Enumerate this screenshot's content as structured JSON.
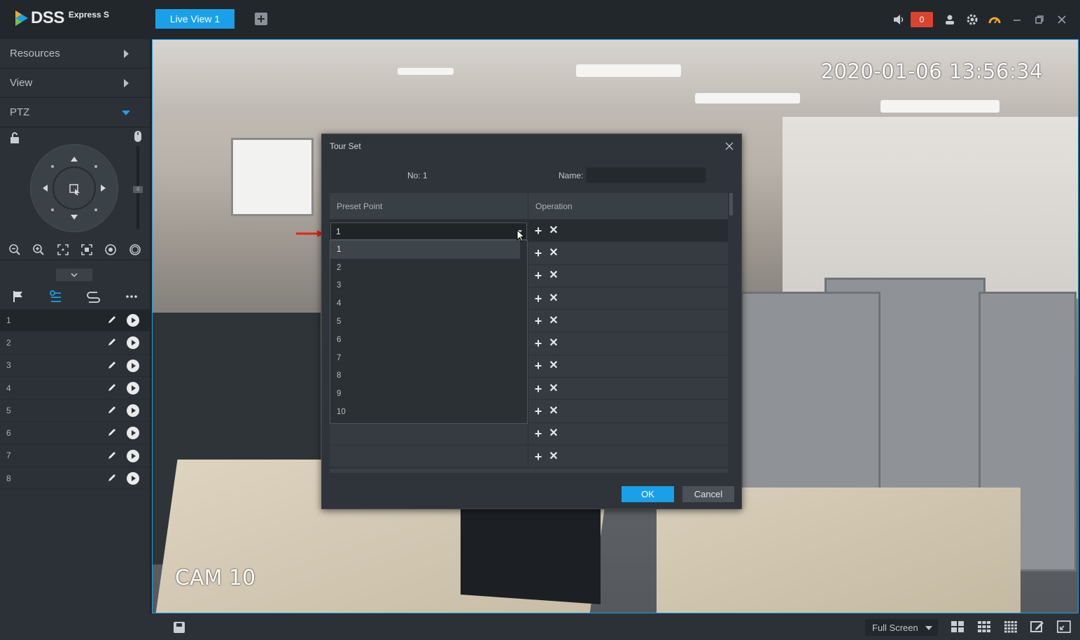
{
  "app": {
    "brand": "DSS",
    "brand_sub": "Express S"
  },
  "tabs": [
    {
      "label": "Live View 1"
    }
  ],
  "topbar": {
    "alarm_count": "0"
  },
  "sidebar": {
    "items": [
      {
        "label": "Resources"
      },
      {
        "label": "View"
      },
      {
        "label": "PTZ"
      }
    ],
    "speed_value": "4",
    "presets": [
      "1",
      "2",
      "3",
      "4",
      "5",
      "6",
      "7",
      "8"
    ]
  },
  "video": {
    "timestamp": "2020-01-06 13:56:34",
    "camera_label": "CAM 10"
  },
  "dialog": {
    "title": "Tour Set",
    "no_label": "No: 1",
    "name_label": "Name:",
    "name_value": "",
    "col_preset": "Preset Point",
    "col_operation": "Operation",
    "selected_preset": "1",
    "options": [
      "1",
      "2",
      "3",
      "4",
      "5",
      "6",
      "7",
      "8",
      "9",
      "10"
    ],
    "row_count": 11,
    "ok_label": "OK",
    "cancel_label": "Cancel"
  },
  "bottombar": {
    "screen_mode": "Full Screen"
  },
  "colors": {
    "accent": "#1aa0e8",
    "alarm": "#d9432f"
  }
}
